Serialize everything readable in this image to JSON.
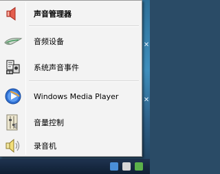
{
  "menu": {
    "items": [
      {
        "label": "声音管理器",
        "icon": "speaker-icon",
        "bold": true
      },
      {
        "label": "音频设备",
        "icon": "audio-device-icon",
        "bold": false
      },
      {
        "label": "系统声音事件",
        "icon": "system-sounds-icon",
        "bold": false
      },
      {
        "label": "Windows Media Player",
        "icon": "media-player-icon",
        "bold": false
      },
      {
        "label": "音量控制",
        "icon": "volume-control-icon",
        "bold": false
      },
      {
        "label": "录音机",
        "icon": "sound-recorder-icon",
        "bold": false
      }
    ]
  },
  "colors": {
    "menu_bg": "#f3f3f3",
    "menu_border": "#979797",
    "speaker_red": "#d8483a",
    "wmp_blue": "#2f6fd1"
  }
}
